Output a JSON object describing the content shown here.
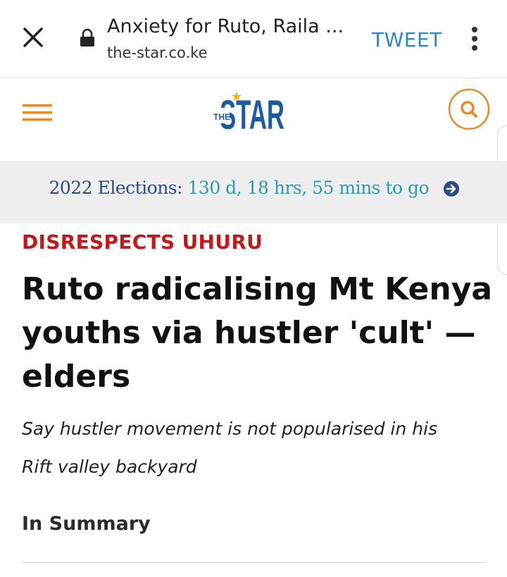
{
  "browser": {
    "title": "Anxiety for Ruto, Raila ...",
    "domain": "the-star.co.ke",
    "tweet_label": "TWEET",
    "icons": {
      "close": "close-icon",
      "lock": "lock-icon",
      "more": "more-vertical-icon"
    }
  },
  "site": {
    "logo_top": "THE",
    "logo_main": "STAR",
    "accent_color": "#e9892c",
    "logo_color": "#1d5aa2"
  },
  "banner": {
    "label": "2022 Elections:",
    "countdown": "130 d, 18 hrs, 55 mins to go"
  },
  "article": {
    "kicker": "DISRESPECTS UHURU",
    "headline": "Ruto radicalising Mt Kenya youths via hustler 'cult' — elders",
    "subhead": "Say hustler movement is not popularised in his Rift valley backyard",
    "summary_label": "In Summary"
  }
}
